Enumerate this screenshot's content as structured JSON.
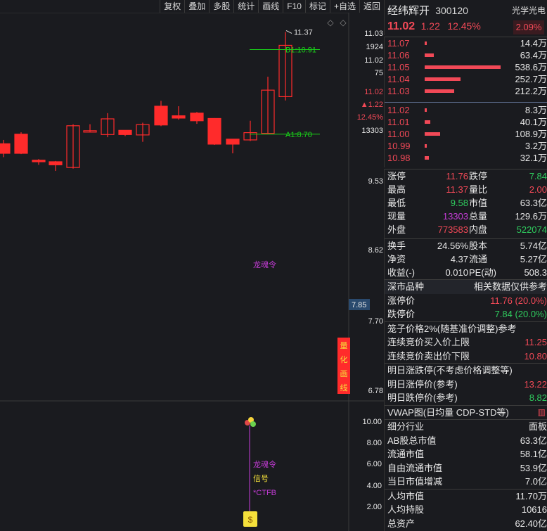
{
  "toolbar": {
    "items": [
      "复权",
      "叠加",
      "多股",
      "统计",
      "画线",
      "F10",
      "标记",
      "+自选",
      "返回"
    ]
  },
  "colors": {
    "up": "#ff2b2b",
    "down": "#00ff00",
    "bg": "#1a1b1f",
    "text_red": "#f24957",
    "text_green": "#2fcc5e"
  },
  "kline": {
    "candles": [
      {
        "o": 8.45,
        "c": 8.2,
        "h": 8.55,
        "l": 8.1
      },
      {
        "o": 8.7,
        "c": 8.2,
        "h": 8.75,
        "l": 8.18
      },
      {
        "o": 8.02,
        "c": 7.98,
        "h": 8.05,
        "l": 7.9
      },
      {
        "o": 7.98,
        "c": 7.9,
        "h": 8.0,
        "l": 7.74
      },
      {
        "o": 7.83,
        "c": 8.92,
        "h": 8.96,
        "l": 7.8
      },
      {
        "o": 8.77,
        "c": 8.79,
        "h": 8.96,
        "l": 8.76
      },
      {
        "o": 8.69,
        "c": 9.1,
        "h": 9.25,
        "l": 8.62
      },
      {
        "o": 8.8,
        "c": 8.69,
        "h": 8.8,
        "l": 8.65
      },
      {
        "o": 8.68,
        "c": 8.95,
        "h": 9.0,
        "l": 8.5
      },
      {
        "o": 9.43,
        "c": 8.94,
        "h": 9.57,
        "l": 8.91
      },
      {
        "o": 9.18,
        "c": 9.12,
        "h": 9.43,
        "l": 9.08
      },
      {
        "o": 9.25,
        "c": 9.05,
        "h": 9.28,
        "l": 8.97
      },
      {
        "o": 9.11,
        "c": 8.44,
        "h": 9.12,
        "l": 8.42
      },
      {
        "o": 8.57,
        "c": 8.44,
        "h": 8.57,
        "l": 8.2
      },
      {
        "o": 8.55,
        "c": 8.74,
        "h": 9.05,
        "l": 8.52
      },
      {
        "o": 8.72,
        "c": 9.85,
        "h": 10.2,
        "l": 8.7
      },
      {
        "o": 9.68,
        "c": 11.02,
        "h": 11.37,
        "l": 9.58
      }
    ],
    "y_labels": [
      "11.03",
      "11.02",
      "9.53",
      "8.62",
      "7.85",
      "7.70",
      "6.78"
    ],
    "side_info": [
      "1924",
      "75",
      "11.02",
      "▲1.22",
      "12.45%",
      "13303"
    ],
    "high_label": "11.37",
    "B1_label": "B1:10.91",
    "A1_label": "A1:8.70",
    "signal_label": "龙魂令",
    "vertical_label": "量化画线"
  },
  "indicator": {
    "y_labels": [
      "10.00",
      "8.00",
      "6.00",
      "4.00",
      "2.00"
    ],
    "labels": [
      "龙魂令",
      "信号",
      "*CTFB"
    ]
  },
  "header": {
    "name": "经纬辉开",
    "code": "300120",
    "sector": "光学光电",
    "price": "11.02",
    "change": "1.22",
    "change_pct": "12.45%",
    "sector_pct": "2.09%"
  },
  "asks": [
    {
      "p": "11.07",
      "v": "14.4万",
      "bar": 0.01
    },
    {
      "p": "11.06",
      "v": "63.4万",
      "bar": 0.12
    },
    {
      "p": "11.05",
      "v": "538.6万",
      "bar": 1.0
    },
    {
      "p": "11.04",
      "v": "252.7万",
      "bar": 0.47
    },
    {
      "p": "11.03",
      "v": "212.2万",
      "bar": 0.39
    }
  ],
  "bids": [
    {
      "p": "11.02",
      "v": "8.3万",
      "bar": 0.01
    },
    {
      "p": "11.01",
      "v": "40.1万",
      "bar": 0.07
    },
    {
      "p": "11.00",
      "v": "108.9万",
      "bar": 0.2
    },
    {
      "p": "10.99",
      "v": "3.2万",
      "bar": 0.01
    },
    {
      "p": "10.98",
      "v": "32.1万",
      "bar": 0.06
    }
  ],
  "stats": [
    {
      "l1": "涨停",
      "v1": "11.76",
      "c1": "red",
      "l2": "跌停",
      "v2": "7.84",
      "c2": "green"
    },
    {
      "l1": "最高",
      "v1": "11.37",
      "c1": "red",
      "l2": "量比",
      "v2": "2.00",
      "c2": "red"
    },
    {
      "l1": "最低",
      "v1": "9.58",
      "c1": "green",
      "l2": "市值",
      "v2": "63.3亿",
      "c2": "white"
    },
    {
      "l1": "现量",
      "v1": "13303",
      "c1": "purple",
      "l2": "总量",
      "v2": "129.6万",
      "c2": "white"
    },
    {
      "l1": "外盘",
      "v1": "773583",
      "c1": "red",
      "l2": "内盘",
      "v2": "522074",
      "c2": "green"
    }
  ],
  "stats2": [
    {
      "l1": "换手",
      "v1": "24.56%",
      "l2": "股本",
      "v2": "5.74亿"
    },
    {
      "l1": "净资",
      "v1": "4.37",
      "l2": "流通",
      "v2": "5.27亿"
    },
    {
      "l1": "收益(-)",
      "v1": "0.010",
      "l2": "PE(动)",
      "v2": "508.3"
    }
  ],
  "section_a": {
    "title": "深市品种",
    "note": "相关数据仅供参考"
  },
  "limit_rows": [
    {
      "label": "涨停价",
      "value": "11.76 (20.0%)",
      "color": "red"
    },
    {
      "label": "跌停价",
      "value": "7.84 (20.0%)",
      "color": "green"
    }
  ],
  "cage": {
    "title": "笼子价格2%(随基准价调整)参考",
    "rows": [
      {
        "label": "连续竞价买入价上限",
        "value": "11.25",
        "color": "red"
      },
      {
        "label": "连续竞价卖出价下限",
        "value": "10.80",
        "color": "red"
      }
    ]
  },
  "tomorrow": {
    "title": "明日涨跌停(不考虑价格调整等)",
    "rows": [
      {
        "label": "明日涨停价(参考)",
        "value": "13.22",
        "color": "red"
      },
      {
        "label": "明日跌停价(参考)",
        "value": "8.82",
        "color": "green"
      }
    ]
  },
  "vwap": {
    "title": "VWAP图(日均量 CDP-STD等)"
  },
  "company": [
    {
      "label": "细分行业",
      "value": "面板"
    },
    {
      "label": "AB股总市值",
      "value": "63.3亿"
    },
    {
      "label": "流通市值",
      "value": "58.1亿"
    },
    {
      "label": "自由流通市值",
      "value": "53.9亿"
    },
    {
      "label": "当日市值增减",
      "value": "7.0亿"
    }
  ],
  "company2": [
    {
      "label": "人均市值",
      "value": "11.70万"
    },
    {
      "label": "人均持股",
      "value": "10616"
    },
    {
      "label": "总资产",
      "value": "62.40亿"
    }
  ]
}
